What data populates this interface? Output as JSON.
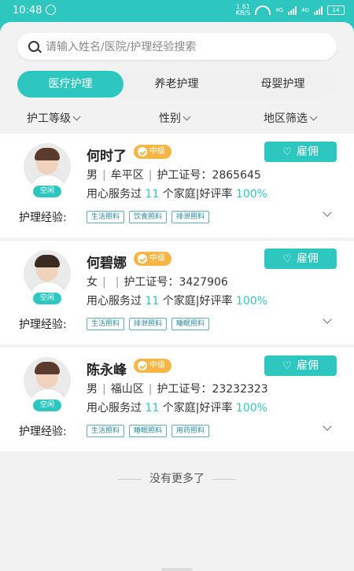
{
  "status_bar": {
    "time": "10:48",
    "speed_value": "1.61",
    "speed_unit": "KB/S",
    "net1": "4G",
    "net2": "4G",
    "battery": "14"
  },
  "search": {
    "placeholder": "请输入姓名/医院/护理经验搜索"
  },
  "tabs": [
    {
      "label": "医疗护理",
      "active": true
    },
    {
      "label": "养老护理",
      "active": false
    },
    {
      "label": "母婴护理",
      "active": false
    }
  ],
  "filters": {
    "level": "护工等级",
    "gender": "性别",
    "region": "地区筛选"
  },
  "common": {
    "free_label": "空闲",
    "hire_label": "雇佣",
    "cert_label": "护工证号：",
    "service_prefix": "用心服务过",
    "service_suffix": "个家庭",
    "rating_label": "好评率",
    "experience_label": "护理经验:",
    "separator": "|"
  },
  "caregivers": [
    {
      "name": "何时了",
      "level": "中级",
      "gender": "男",
      "region": "牟平区",
      "cert_no": "2865645",
      "families": "11",
      "rating": "100%",
      "tags": [
        "生活照料",
        "饮食照料",
        "排泄照料"
      ]
    },
    {
      "name": "何碧娜",
      "level": "中级",
      "gender": "女",
      "region": "",
      "cert_no": "3427906",
      "families": "11",
      "rating": "100%",
      "tags": [
        "生活照料",
        "排泄照料",
        "睡眠照料"
      ]
    },
    {
      "name": "陈永峰",
      "level": "中级",
      "gender": "男",
      "region": "福山区",
      "cert_no": "23232323",
      "families": "11",
      "rating": "100%",
      "tags": [
        "生活照料",
        "睡眠照料",
        "用药照料"
      ]
    }
  ],
  "footer": {
    "no_more": "没有更多了"
  },
  "colors": {
    "accent": "#2ec7c0",
    "level_badge": "#f7b643"
  }
}
